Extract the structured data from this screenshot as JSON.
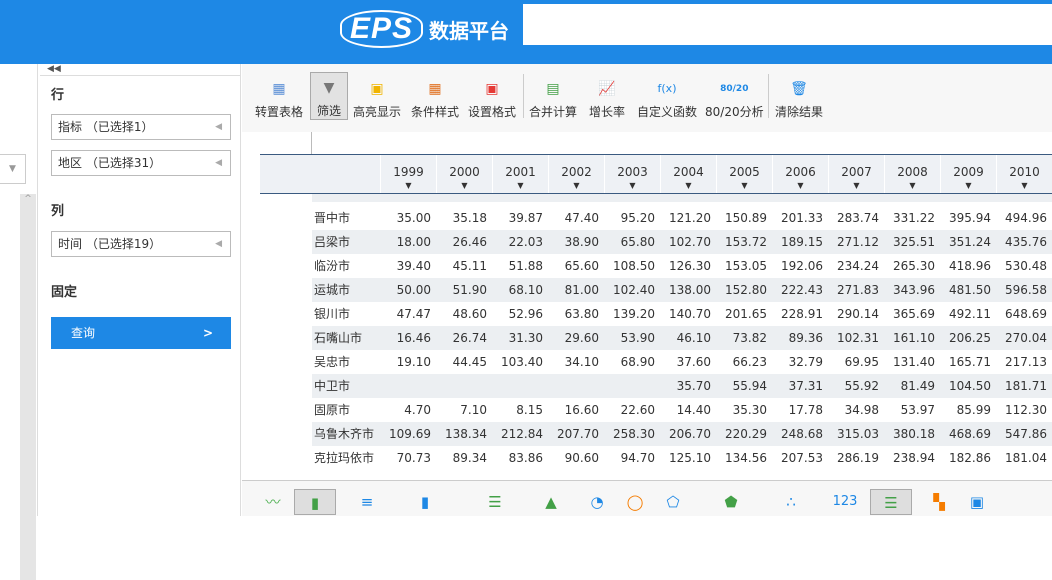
{
  "header": {
    "logo_text": "EPS",
    "title": "数据平台",
    "search_value": ""
  },
  "config": {
    "row_heading": "行",
    "col_heading": "列",
    "fixed_heading": "固定",
    "row_dims": [
      "指标 （已选择1）",
      "地区 （已选择31）"
    ],
    "col_dims": [
      "时间 （已选择19）"
    ],
    "query_label": "查询"
  },
  "toolbar": [
    "转置表格",
    "筛选",
    "高亮显示",
    "条件样式",
    "设置格式",
    "合并计算",
    "增长率",
    "自定义函数",
    "80/20分析",
    "清除结果"
  ],
  "table": {
    "years": [
      "1999",
      "2000",
      "2001",
      "2002",
      "2003",
      "2004",
      "2005",
      "2006",
      "2007",
      "2008",
      "2009",
      "2010"
    ],
    "rows": [
      {
        "name": "晋中市",
        "values": [
          "35.00",
          "35.18",
          "39.87",
          "47.40",
          "95.20",
          "121.20",
          "150.89",
          "201.33",
          "283.74",
          "331.22",
          "395.94",
          "494.96"
        ]
      },
      {
        "name": "吕梁市",
        "values": [
          "18.00",
          "26.46",
          "22.03",
          "38.90",
          "65.80",
          "102.70",
          "153.72",
          "189.15",
          "271.12",
          "325.51",
          "351.24",
          "435.76"
        ]
      },
      {
        "name": "临汾市",
        "values": [
          "39.40",
          "45.11",
          "51.88",
          "65.60",
          "108.50",
          "126.30",
          "153.05",
          "192.06",
          "234.24",
          "265.30",
          "418.96",
          "530.48"
        ]
      },
      {
        "name": "运城市",
        "values": [
          "50.00",
          "51.90",
          "68.10",
          "81.00",
          "102.40",
          "138.00",
          "152.80",
          "222.43",
          "271.83",
          "343.96",
          "481.50",
          "596.58"
        ]
      },
      {
        "name": "银川市",
        "values": [
          "47.47",
          "48.60",
          "52.96",
          "63.80",
          "139.20",
          "140.70",
          "201.65",
          "228.91",
          "290.14",
          "365.69",
          "492.11",
          "648.69"
        ]
      },
      {
        "name": "石嘴山市",
        "values": [
          "16.46",
          "26.74",
          "31.30",
          "29.60",
          "53.90",
          "46.10",
          "73.82",
          "89.36",
          "102.31",
          "161.10",
          "206.25",
          "270.04"
        ]
      },
      {
        "name": "吴忠市",
        "values": [
          "19.10",
          "44.45",
          "103.40",
          "34.10",
          "68.90",
          "37.60",
          "66.23",
          "32.79",
          "69.95",
          "131.40",
          "165.71",
          "217.13"
        ]
      },
      {
        "name": "中卫市",
        "values": [
          "",
          "",
          "",
          "",
          "",
          "35.70",
          "55.94",
          "37.31",
          "55.92",
          "81.49",
          "104.50",
          "181.71"
        ]
      },
      {
        "name": "固原市",
        "values": [
          "4.70",
          "7.10",
          "8.15",
          "16.60",
          "22.60",
          "14.40",
          "35.30",
          "17.78",
          "34.98",
          "53.97",
          "85.99",
          "112.30"
        ]
      },
      {
        "name": "乌鲁木齐市",
        "values": [
          "109.69",
          "138.34",
          "212.84",
          "207.70",
          "258.30",
          "206.70",
          "220.29",
          "248.68",
          "315.03",
          "380.18",
          "468.69",
          "547.86"
        ]
      },
      {
        "name": "克拉玛依市",
        "values": [
          "70.73",
          "89.34",
          "83.86",
          "90.60",
          "94.70",
          "125.10",
          "134.56",
          "207.53",
          "286.19",
          "238.94",
          "182.86",
          "181.04"
        ]
      }
    ]
  },
  "chart_types": [
    "line-chart-icon",
    "bar-chart-icon",
    "horizontal-bar-icon",
    "stacked-bar-icon",
    "stacked-horizontal-bar-icon",
    "area-chart-icon",
    "pie-chart-icon",
    "donut-chart-icon",
    "radar-chart-icon",
    "filled-radar-icon",
    "scatter-icon",
    "number-view-icon",
    "list-view-icon",
    "dashboard-icon",
    "image-export-icon"
  ],
  "number_view_label": "123"
}
